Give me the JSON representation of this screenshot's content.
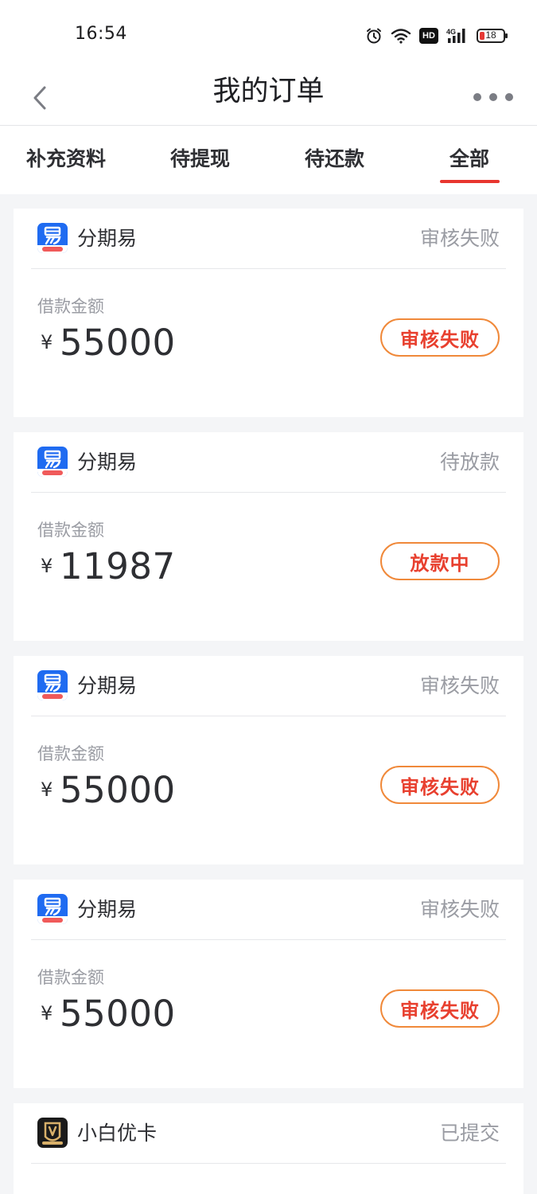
{
  "status_bar": {
    "time": "16:54",
    "battery": "18",
    "network": "4G",
    "hd": "HD",
    "icons": [
      "alarm-icon",
      "wifi-icon",
      "hd-icon",
      "signal-icon",
      "battery-icon"
    ]
  },
  "nav": {
    "title": "我的订单",
    "back_icon": "chevron-left-icon",
    "more_icon": "more-dots-icon"
  },
  "tabs": [
    {
      "label": "补充资料",
      "active": false
    },
    {
      "label": "待提现",
      "active": false
    },
    {
      "label": "待还款",
      "active": false
    },
    {
      "label": "全部",
      "active": true
    }
  ],
  "colors": {
    "accent": "#e8362f",
    "badge_border": "#f0893a",
    "badge_text": "#e8402f",
    "muted": "#9a9ca3",
    "background": "#f4f5f7"
  },
  "orders": [
    {
      "app_name": "分期易",
      "app_icon": "fenqiyi-logo-icon",
      "status": "审核失败",
      "amount_label": "借款金额",
      "currency": "¥",
      "amount": "55000",
      "badge": "审核失败"
    },
    {
      "app_name": "分期易",
      "app_icon": "fenqiyi-logo-icon",
      "status": "待放款",
      "amount_label": "借款金额",
      "currency": "¥",
      "amount": "11987",
      "badge": "放款中"
    },
    {
      "app_name": "分期易",
      "app_icon": "fenqiyi-logo-icon",
      "status": "审核失败",
      "amount_label": "借款金额",
      "currency": "¥",
      "amount": "55000",
      "badge": "审核失败"
    },
    {
      "app_name": "分期易",
      "app_icon": "fenqiyi-logo-icon",
      "status": "审核失败",
      "amount_label": "借款金额",
      "currency": "¥",
      "amount": "55000",
      "badge": "审核失败"
    },
    {
      "app_name": "小白优卡",
      "app_icon": "xiaobaiyouka-logo-icon",
      "status": "已提交"
    }
  ]
}
